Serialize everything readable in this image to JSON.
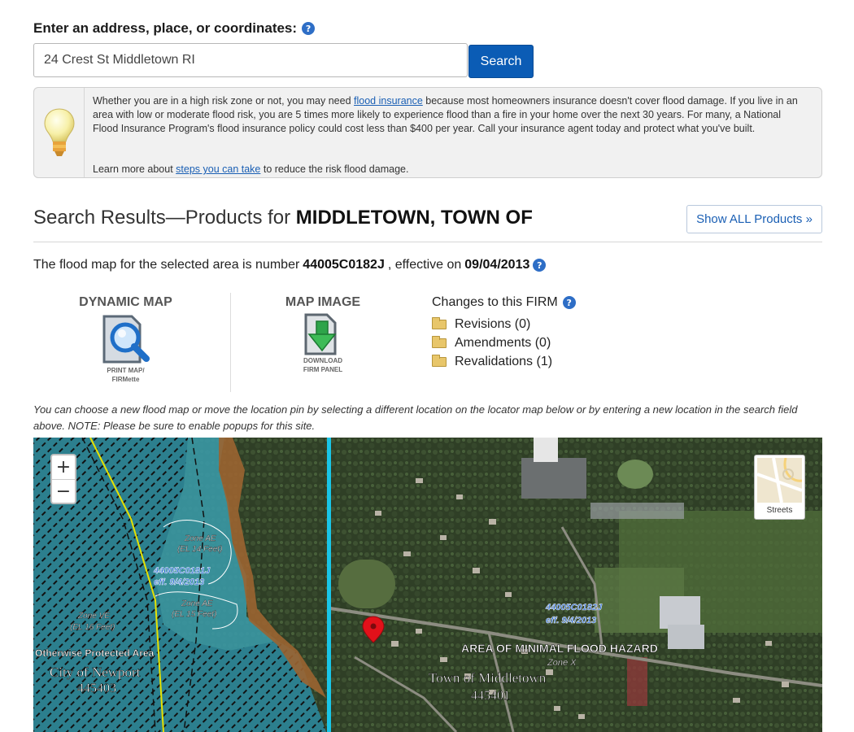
{
  "search": {
    "label": "Enter an address, place, or coordinates:",
    "value": "24 Crest St Middletown RI",
    "button": "Search"
  },
  "tip": {
    "text_before": "Whether you are in a high risk zone or not, you may need ",
    "link1": "flood insurance",
    "text_after": " because most homeowners insurance doesn't cover flood damage. If you live in an area with low or moderate flood risk, you are 5 times more likely to experience flood than a fire in your home over the next 30 years. For many, a National Flood Insurance Program's flood insurance policy could cost less than $400 per year. Call your insurance agent today and protect what you've built.",
    "learn_before": "Learn more about ",
    "learn_link": "steps you can take",
    "learn_after": " to reduce the risk flood damage."
  },
  "results": {
    "prefix": "Search Results—Products for ",
    "community": "MIDDLETOWN, TOWN OF",
    "show_all": "Show ALL Products »",
    "map_prefix": "The flood map for the selected area is number ",
    "map_number": "44005C0182J",
    "effective_label": ", effective on ",
    "effective_date": "09/04/2013"
  },
  "products": {
    "dynamic_title": "DYNAMIC MAP",
    "dynamic_sub1": "PRINT MAP/",
    "dynamic_sub2": "FIRMette",
    "image_title": "MAP IMAGE",
    "image_sub1": "DOWNLOAD",
    "image_sub2": "FIRM PANEL"
  },
  "changes": {
    "title": "Changes to this FIRM",
    "items": [
      {
        "label": "Revisions (0)"
      },
      {
        "label": "Amendments (0)"
      },
      {
        "label": "Revalidations (1)"
      }
    ]
  },
  "instructions": "You can choose a new flood map or move the location pin by selecting a different location on the locator map below or by entering a new location in the search field above. NOTE: Please be sure to enable popups for this site.",
  "map": {
    "zoom_in": "+",
    "zoom_out": "−",
    "basemap_label": "Streets",
    "labels": {
      "zone_ae_14": "Zone AE",
      "el_14": "(EL 14 Feet)",
      "panel_181": "44005C0181J",
      "panel_181_eff": "eff. 9/4/2013",
      "zone_ae_15": "Zone AE",
      "el_15": "(EL 15 Feet)",
      "zone_ve": "Zone VE",
      "el_16": "(EL 16 Feet)",
      "otherwise": "Otherwise Protected Area",
      "newport": "City of Newport",
      "newport_id": "445403",
      "panel_182": "44005C0182J",
      "panel_182_eff": "eff. 9/4/2013",
      "minimal": "AREA OF MINIMAL FLOOD HAZARD",
      "zone_x": "Zone X",
      "middletown": "Town of Middletown",
      "middletown_id": "445401"
    }
  }
}
